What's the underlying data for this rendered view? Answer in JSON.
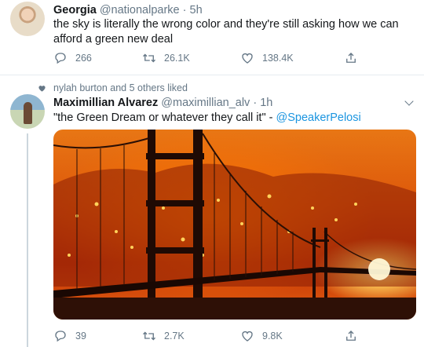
{
  "tweet1": {
    "name": "Georgia",
    "handle": "@nationalparke",
    "separator": "·",
    "time": "5h",
    "text": "the sky is literally the wrong color and they're still asking how we can afford a green new deal",
    "reply_count": "266",
    "retweet_count": "26.1K",
    "like_count": "138.4K"
  },
  "tweet2": {
    "social_context": "nylah burton and 5 others liked",
    "name": "Maximillian Alvarez",
    "handle": "@maximillian_alv",
    "separator": "·",
    "time": "1h",
    "text": "\"the Green Dream or whatever they call it\" - ",
    "mention": "@SpeakerPelosi",
    "reply_count": "39",
    "retweet_count": "2.7K",
    "like_count": "9.8K"
  },
  "icons": {
    "reply": "reply-icon",
    "retweet": "retweet-icon",
    "like": "heart-icon",
    "share": "share-icon",
    "more": "chevron-down-icon",
    "liked_context": "heart-icon"
  },
  "colors": {
    "text": "#14171a",
    "secondary": "#657786",
    "link": "#1b95e0",
    "divider": "#e6ecf0"
  }
}
